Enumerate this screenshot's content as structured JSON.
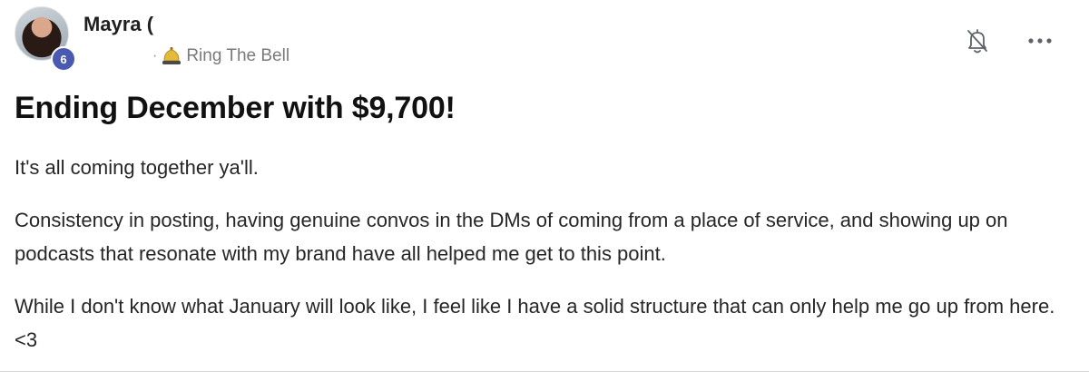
{
  "author": {
    "name": "Mayra (",
    "level": "6"
  },
  "category": {
    "separator": "·",
    "label": "Ring The Bell"
  },
  "actions": {
    "mute_icon": "bell-slash-icon",
    "more_icon": "more-horizontal-icon"
  },
  "post": {
    "title": "Ending December with $9,700!",
    "paragraphs": [
      "It's all coming together ya'll.",
      "Consistency in posting, having genuine convos in the DMs of coming from a place of service, and showing up on podcasts that resonate with my brand have all helped me get to this point.",
      "While I don't know what January will look like, I feel like I have a solid structure that can only help me go up from here. <3"
    ]
  },
  "colors": {
    "badge": "#4a5ab0",
    "text": "#262626",
    "muted": "#7a7a7a"
  }
}
